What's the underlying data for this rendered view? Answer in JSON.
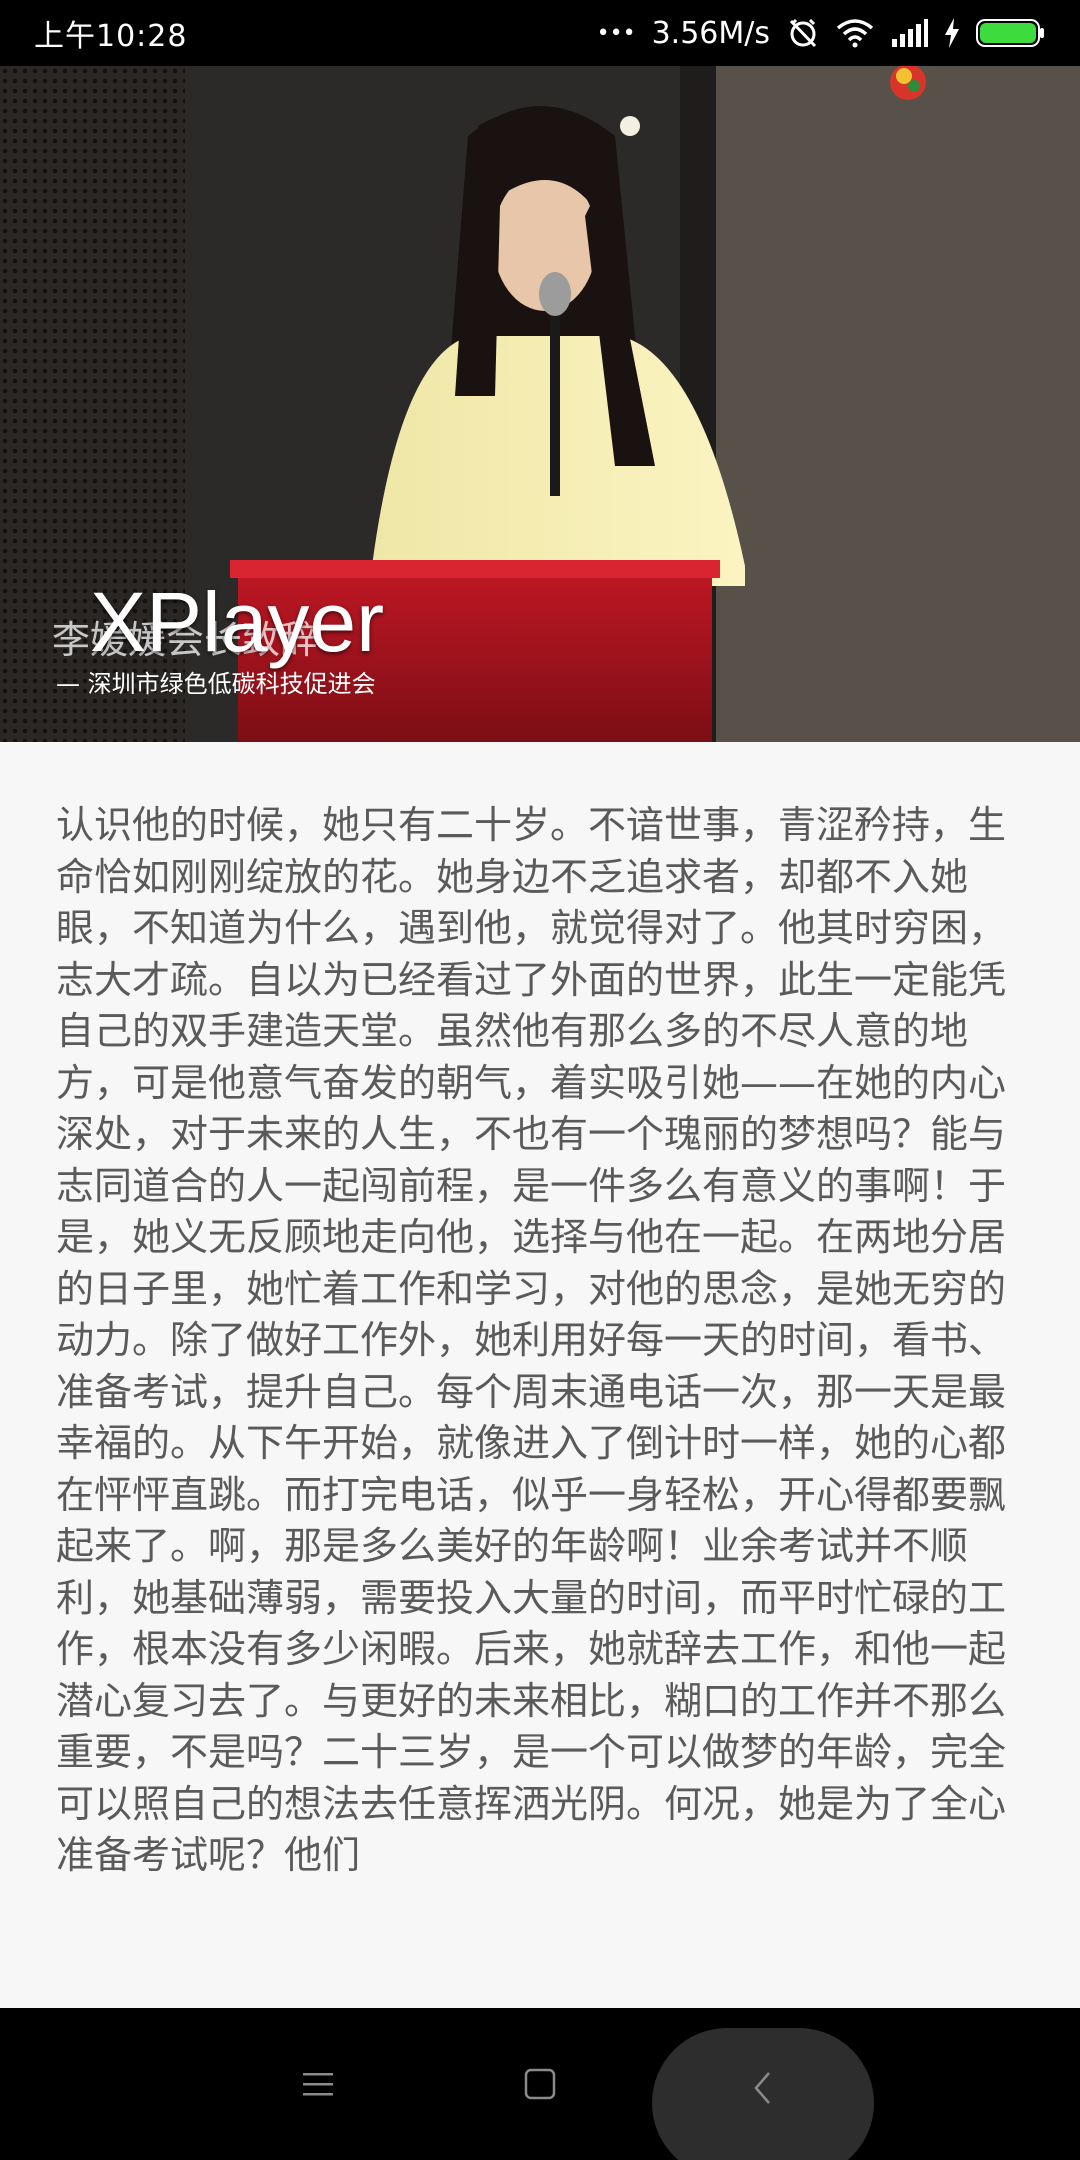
{
  "status_bar": {
    "time": "上午10:28",
    "dots": "•••",
    "net_speed": "3.56M/s",
    "icons": [
      "alarm-muted-icon",
      "wifi-icon",
      "signal-icon",
      "charging-icon",
      "battery-icon"
    ],
    "battery_color": "#3ddc3d"
  },
  "video": {
    "player_title": "XPlayer",
    "caption_title": "李媛媛会长致辞",
    "caption_subtitle": "— 深圳市绿色低碳科技促进会"
  },
  "article": {
    "text": "认识他的时候，她只有二十岁。不谙世事，青涩矜持，生命恰如刚刚绽放的花。她身边不乏追求者，却都不入她眼，不知道为什么，遇到他，就觉得对了。他其时穷困，志大才疏。自以为已经看过了外面的世界，此生一定能凭自己的双手建造天堂。虽然他有那么多的不尽人意的地方，可是他意气奋发的朝气，着实吸引她——在她的内心深处，对于未来的人生，不也有一个瑰丽的梦想吗？能与志同道合的人一起闯前程，是一件多么有意义的事啊！于是，她义无反顾地走向他，选择与他在一起。在两地分居的日子里，她忙着工作和学习，对他的思念，是她无穷的动力。除了做好工作外，她利用好每一天的时间，看书、准备考试，提升自己。每个周末通电话一次，那一天是最幸福的。从下午开始，就像进入了倒计时一样，她的心都在怦怦直跳。而打完电话，似乎一身轻松，开心得都要飘起来了。啊，那是多么美好的年龄啊！业余考试并不顺利，她基础薄弱，需要投入大量的时间，而平时忙碌的工作，根本没有多少闲暇。后来，她就辞去工作，和他一起潜心复习去了。与更好的未来相比，糊口的工作并不那么重要，不是吗？二十三岁，是一个可以做梦的年龄，完全可以照自己的想法去任意挥洒光阴。何况，她是为了全心准备考试呢？他们"
  },
  "nav_bar": {
    "buttons": [
      "menu-icon",
      "home-icon",
      "back-icon"
    ]
  }
}
